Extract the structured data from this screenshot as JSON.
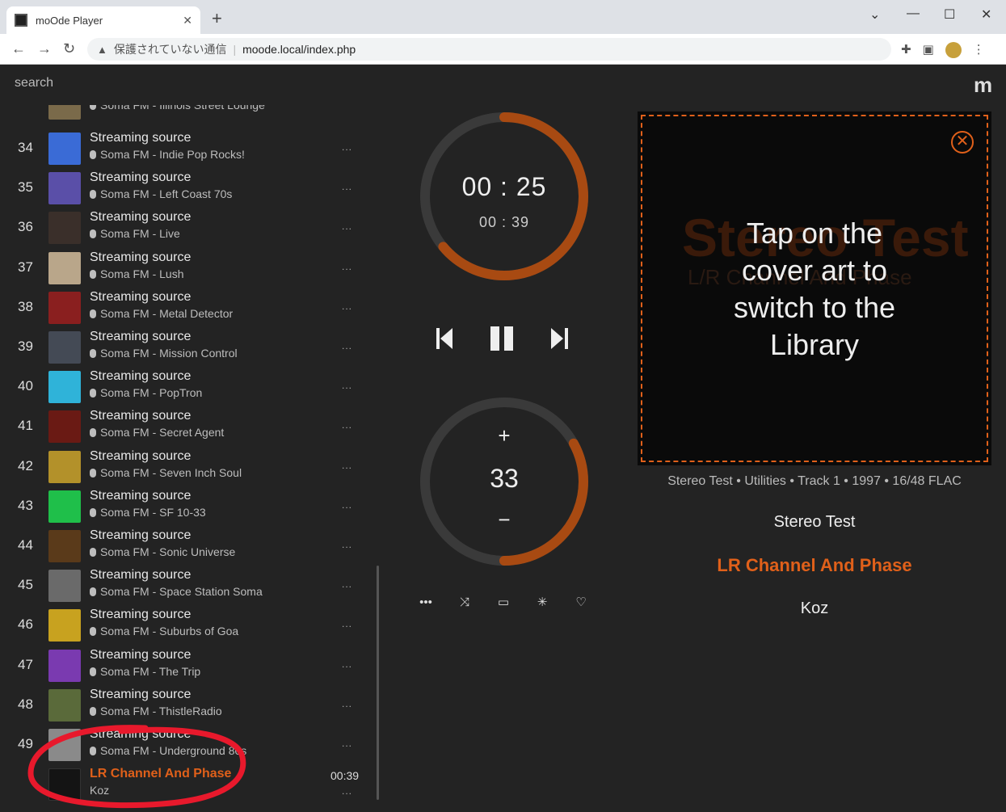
{
  "browser": {
    "tab_title": "moOde Player",
    "insecure_label": "保護されていない通信",
    "url": "moode.local/index.php"
  },
  "app": {
    "search_label": "search",
    "logo": "m"
  },
  "playlist": {
    "partial_top": "Soma FM - Illinois Street Lounge",
    "items": [
      {
        "num": "34",
        "title": "Streaming source",
        "sub": "Soma FM - Indie Pop Rocks!",
        "thumb": "#3a6bd6"
      },
      {
        "num": "35",
        "title": "Streaming source",
        "sub": "Soma FM - Left Coast 70s",
        "thumb": "#5a4fa8"
      },
      {
        "num": "36",
        "title": "Streaming source",
        "sub": "Soma FM - Live",
        "thumb": "#3a2f2a"
      },
      {
        "num": "37",
        "title": "Streaming source",
        "sub": "Soma FM - Lush",
        "thumb": "#b9a68a"
      },
      {
        "num": "38",
        "title": "Streaming source",
        "sub": "Soma FM - Metal Detector",
        "thumb": "#8a1f1f"
      },
      {
        "num": "39",
        "title": "Streaming source",
        "sub": "Soma FM - Mission Control",
        "thumb": "#444a55"
      },
      {
        "num": "40",
        "title": "Streaming source",
        "sub": "Soma FM - PopTron",
        "thumb": "#2fb3d9"
      },
      {
        "num": "41",
        "title": "Streaming source",
        "sub": "Soma FM - Secret Agent",
        "thumb": "#6a1a14"
      },
      {
        "num": "42",
        "title": "Streaming source",
        "sub": "Soma FM - Seven Inch Soul",
        "thumb": "#b3912a"
      },
      {
        "num": "43",
        "title": "Streaming source",
        "sub": "Soma FM - SF 10-33",
        "thumb": "#1fbf4a"
      },
      {
        "num": "44",
        "title": "Streaming source",
        "sub": "Soma FM - Sonic Universe",
        "thumb": "#5a3a1a"
      },
      {
        "num": "45",
        "title": "Streaming source",
        "sub": "Soma FM - Space Station Soma",
        "thumb": "#6a6a6a"
      },
      {
        "num": "46",
        "title": "Streaming source",
        "sub": "Soma FM - Suburbs of Goa",
        "thumb": "#c8a21f"
      },
      {
        "num": "47",
        "title": "Streaming source",
        "sub": "Soma FM - The Trip",
        "thumb": "#7a3ab0"
      },
      {
        "num": "48",
        "title": "Streaming source",
        "sub": "Soma FM - ThistleRadio",
        "thumb": "#5a6a3a"
      },
      {
        "num": "49",
        "title": "Streaming source",
        "sub": "Soma FM - Underground 80s",
        "thumb": "#8a8a8a"
      }
    ],
    "active": {
      "title": "LR Channel And Phase",
      "artist": "Koz",
      "time": "00:39"
    },
    "menu_glyph": "..."
  },
  "player": {
    "elapsed": "00 : 25",
    "total": "00 : 39",
    "progress_fraction": 0.64,
    "volume": "33",
    "volume_fraction": 0.33,
    "vol_plus": "+",
    "vol_minus": "−"
  },
  "cover": {
    "art_line1": "Stereo Test",
    "art_line2": "L/R Channel And Phase",
    "hint": "Tap on the cover art to switch to the Library"
  },
  "track": {
    "meta": "Stereo Test • Utilities • Track 1 • 1997 • 16/48 FLAC",
    "album": "Stereo Test",
    "title": "LR Channel And Phase",
    "artist": "Koz"
  },
  "colors": {
    "accent": "#e0601a",
    "annotation": "#e8192c"
  }
}
